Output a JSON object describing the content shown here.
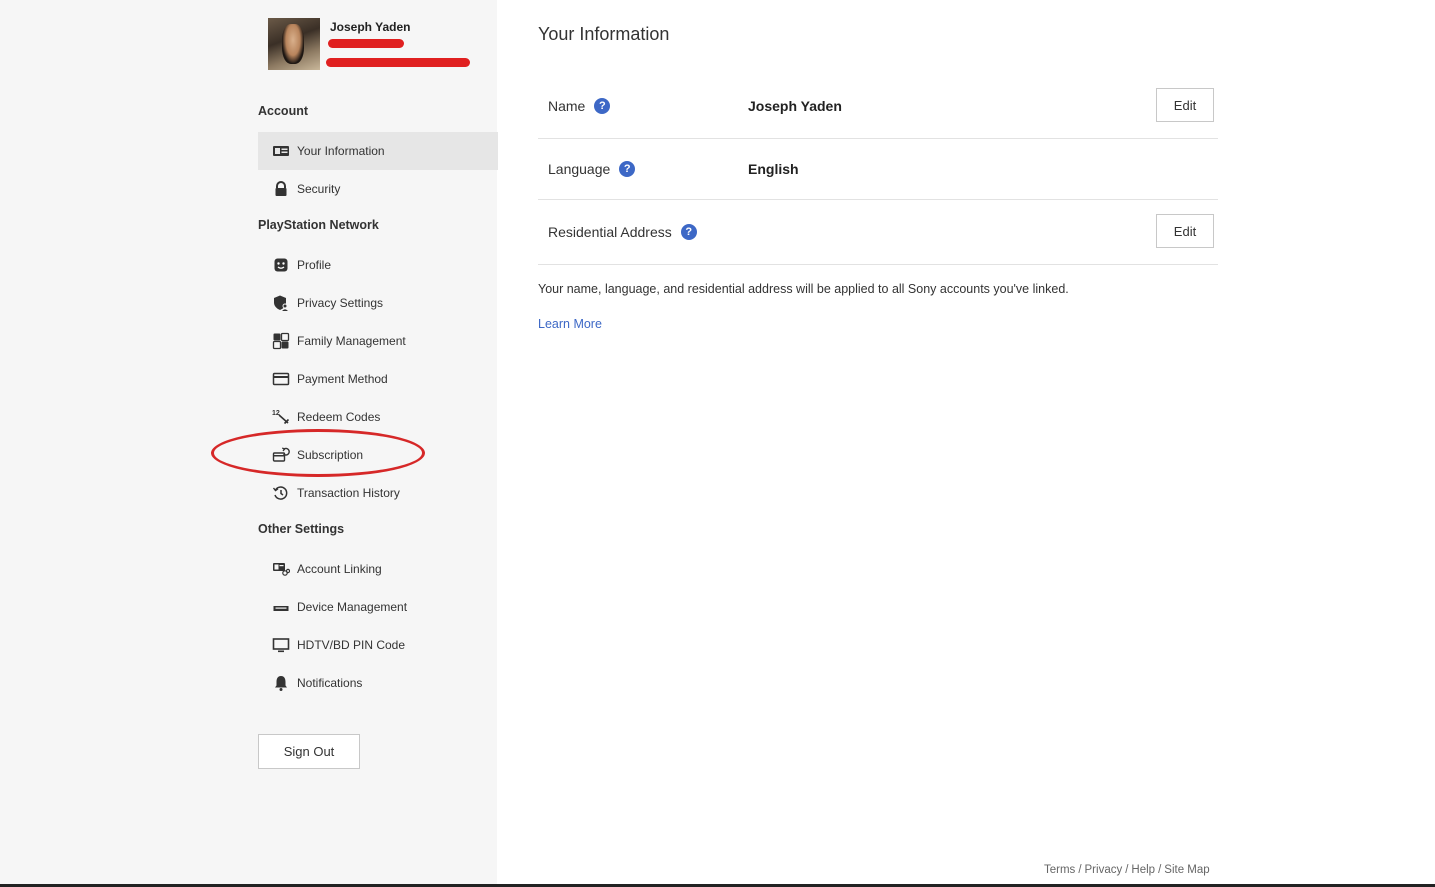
{
  "user": {
    "name": "Joseph Yaden"
  },
  "sidebar": {
    "sections": [
      {
        "title": "Account"
      },
      {
        "title": "PlayStation Network"
      },
      {
        "title": "Other Settings"
      }
    ],
    "items": [
      {
        "label": "Your Information",
        "icon": "id-card-icon",
        "active": true
      },
      {
        "label": "Security",
        "icon": "lock-icon"
      },
      {
        "label": "Profile",
        "icon": "smiley-icon"
      },
      {
        "label": "Privacy Settings",
        "icon": "privacy-shield-icon"
      },
      {
        "label": "Family Management",
        "icon": "family-icon"
      },
      {
        "label": "Payment Method",
        "icon": "credit-card-icon"
      },
      {
        "label": "Redeem Codes",
        "icon": "redeem-icon"
      },
      {
        "label": "Subscription",
        "icon": "subscription-icon"
      },
      {
        "label": "Transaction History",
        "icon": "history-icon"
      },
      {
        "label": "Account Linking",
        "icon": "link-icon"
      },
      {
        "label": "Device Management",
        "icon": "device-icon"
      },
      {
        "label": "HDTV/BD PIN Code",
        "icon": "monitor-icon"
      },
      {
        "label": "Notifications",
        "icon": "bell-icon"
      }
    ],
    "signout_label": "Sign Out"
  },
  "main": {
    "title": "Your Information",
    "rows": [
      {
        "label": "Name",
        "value": "Joseph Yaden",
        "edit": "Edit"
      },
      {
        "label": "Language",
        "value": "English"
      },
      {
        "label": "Residential Address",
        "value": "",
        "edit": "Edit"
      }
    ],
    "note": "Your name, language, and residential address will be applied to all Sony accounts you've linked.",
    "learn_more": "Learn More"
  },
  "footer": {
    "links": [
      "Terms",
      "Privacy",
      "Help",
      "Site Map"
    ]
  },
  "colors": {
    "accent": "#3d68c6",
    "annotation": "#d62828",
    "sidebar_bg": "#f6f6f6"
  }
}
